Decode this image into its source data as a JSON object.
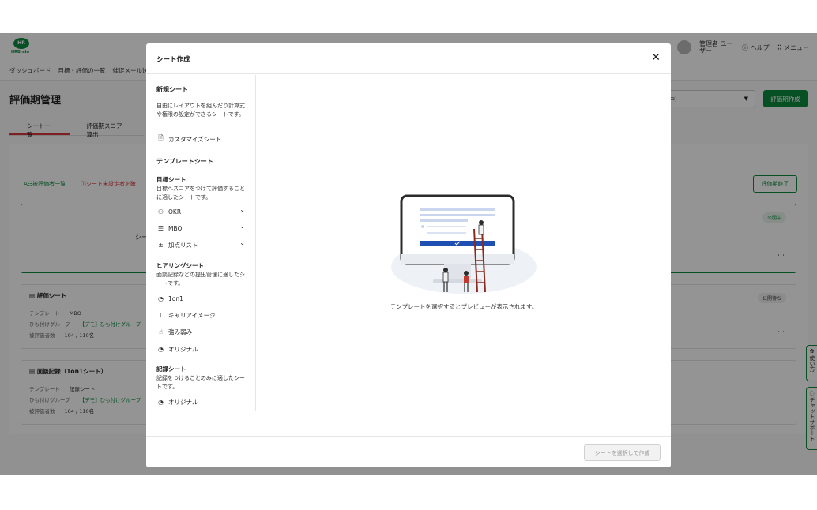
{
  "header": {
    "logo_text": "HR",
    "logo_sub": "HRBrain",
    "user_name": "管理者 ユーザー",
    "help_label": "ヘルプ",
    "menu_label": "メニュー"
  },
  "nav": {
    "items": [
      "ダッシュボード",
      "目標・評価の一覧",
      "催促メール送"
    ]
  },
  "page": {
    "title": "評価期管理",
    "tabs": [
      "シート一覧",
      "評価期スコア算出"
    ],
    "create_button": "評価期作成",
    "select_value": "中)",
    "end_button": "評価期終了",
    "list_head": "被評価者一覧",
    "list_warn": "シート未設定者を確",
    "card0_partial": "シー",
    "card0_status": "公開中",
    "cards": [
      {
        "title": "評価シート",
        "template_label": "テンプレート",
        "template_value": "MBO",
        "group_label": "ひも付けグループ",
        "group_value": "【デモ】ひも付けグループ",
        "count_label": "被評価者数",
        "count_value": "104 / 110名",
        "status": "公開待ち"
      },
      {
        "title": "面談記録（1on1シート）",
        "template_label": "テンプレート",
        "template_value": "記録シート",
        "group_label": "ひも付けグループ",
        "group_value": "【デモ】ひも付けグループ",
        "count_label": "被評価者数",
        "count_value": "104 / 110名"
      }
    ],
    "side_tabs": [
      "使い方",
      "チャットサポート"
    ]
  },
  "modal": {
    "title": "シート作成",
    "new_section": {
      "title": "新規シート",
      "desc": "自由にレイアウトを組んだり計算式や権限の設定ができるシートです。",
      "item": "カスタマイズシート"
    },
    "template_section": {
      "title": "テンプレートシート",
      "goal": {
        "title": "目標シート",
        "desc": "目標へスコアをつけて評価することに適したシートです。",
        "items": [
          "OKR",
          "MBO",
          "加点リスト"
        ]
      },
      "hearing": {
        "title": "ヒアリングシート",
        "desc": "面談記録などの提出管理に適したシートです。",
        "items": [
          "1on1",
          "キャリアイメージ",
          "強み弱み",
          "オリジナル"
        ]
      },
      "record": {
        "title": "記録シート",
        "desc": "記録をつけることのみに適したシートです。",
        "items": [
          "オリジナル"
        ]
      }
    },
    "preview_message": "テンプレートを選択するとプレビューが表示されます。",
    "submit_label": "シートを選択して作成"
  }
}
